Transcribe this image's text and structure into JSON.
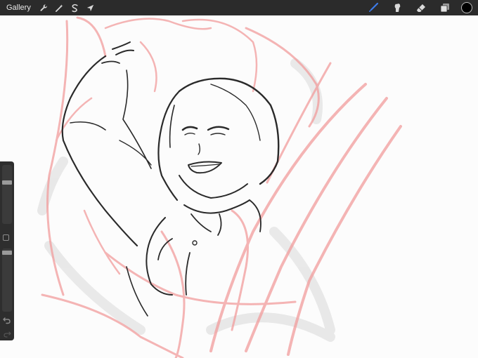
{
  "toolbar": {
    "gallery_label": "Gallery",
    "left_tools": [
      {
        "name": "actions",
        "icon": "wrench-icon"
      },
      {
        "name": "adjustments",
        "icon": "magic-wand-icon"
      },
      {
        "name": "selection",
        "icon": "selection-s-icon"
      },
      {
        "name": "transform",
        "icon": "arrow-cursor-icon"
      }
    ],
    "right_tools": [
      {
        "name": "brush",
        "icon": "brush-icon",
        "active": true
      },
      {
        "name": "smudge",
        "icon": "smudge-icon"
      },
      {
        "name": "eraser",
        "icon": "eraser-icon"
      },
      {
        "name": "layers",
        "icon": "layers-icon"
      }
    ],
    "current_color": "#000000",
    "active_color": "#3d7be8"
  },
  "sidebar": {
    "brush_size": 0.72,
    "brush_opacity": 0.96,
    "modify_icon": "square-icon",
    "undo_icon": "undo-icon",
    "redo_icon": "redo-icon"
  },
  "canvas": {
    "sketch_color": "#f29c9c",
    "lineart_color": "#2a2a2a"
  }
}
